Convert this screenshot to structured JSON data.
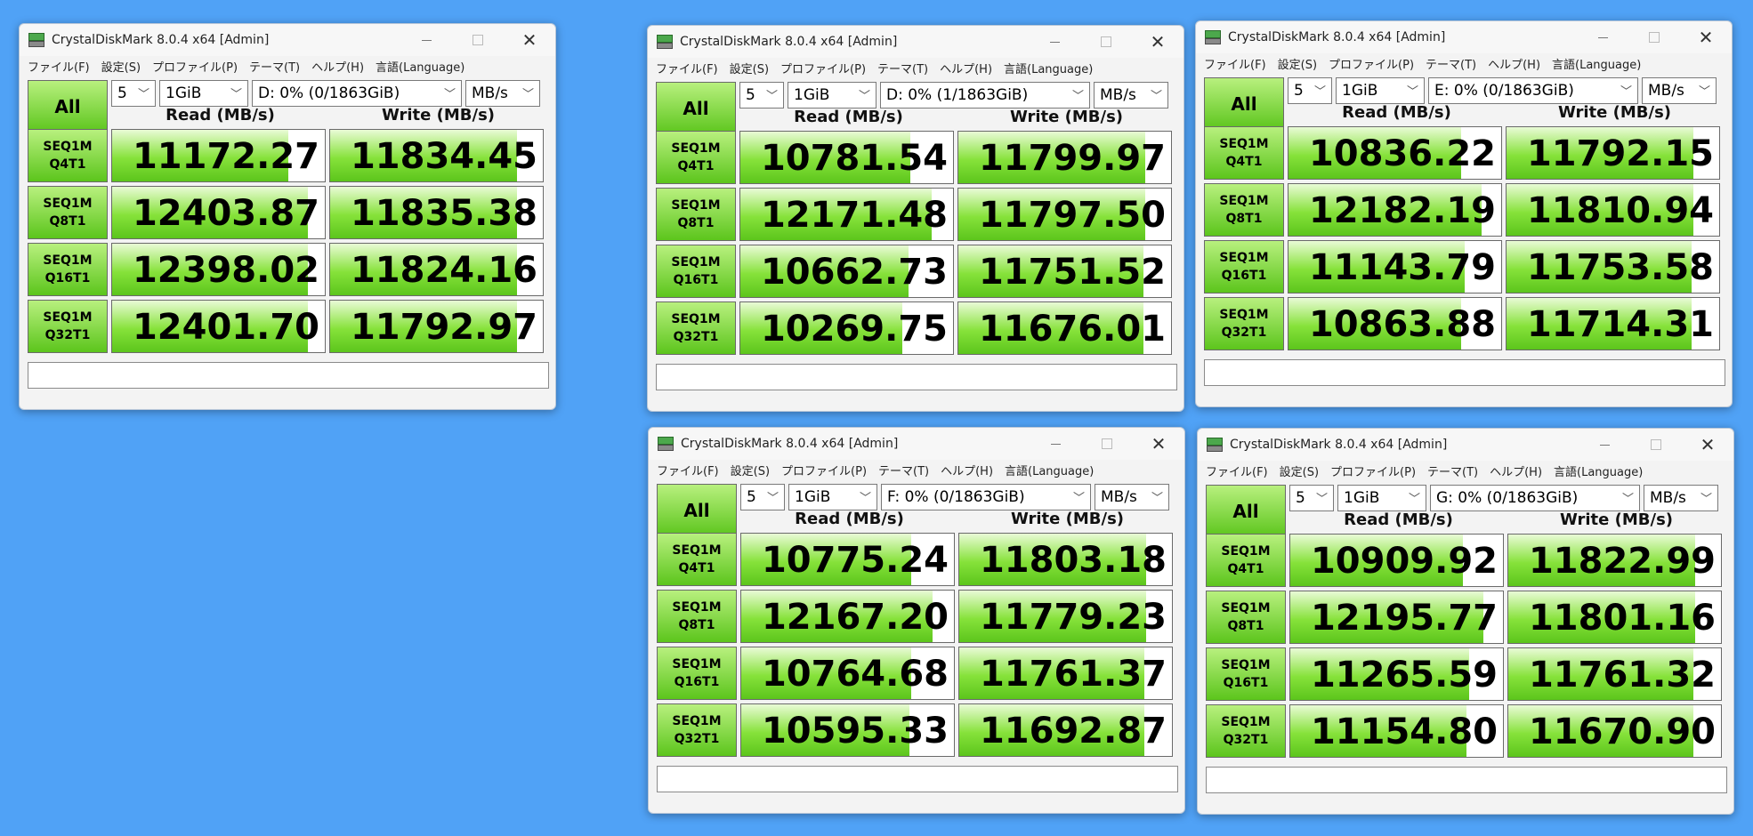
{
  "common": {
    "title": "CrystalDiskMark 8.0.4 x64 [Admin]",
    "menu": [
      "ファイル(F)",
      "設定(S)",
      "プロファイル(P)",
      "テーマ(T)",
      "ヘルプ(H)",
      "言語(Language)"
    ],
    "all_label": "All",
    "count": "5",
    "size": "1GiB",
    "unit": "MB/s",
    "read_header": "Read (MB/s)",
    "write_header": "Write (MB/s)",
    "tests": [
      {
        "line1": "SEQ1M",
        "line2": "Q4T1"
      },
      {
        "line1": "SEQ1M",
        "line2": "Q8T1"
      },
      {
        "line1": "SEQ1M",
        "line2": "Q16T1"
      },
      {
        "line1": "SEQ1M",
        "line2": "Q32T1"
      }
    ],
    "accent_green": "#5cc51c",
    "desktop_blue": "#50a2f6"
  },
  "windows": [
    {
      "drive": "D: 0% (0/1863GiB)",
      "read": [
        "11172.27",
        "12403.87",
        "12398.02",
        "12401.70"
      ],
      "write": [
        "11834.45",
        "11835.38",
        "11824.16",
        "11792.97"
      ],
      "read_fill": [
        0.83,
        0.92,
        0.92,
        0.92
      ],
      "write_fill": [
        0.88,
        0.88,
        0.88,
        0.88
      ]
    },
    {
      "drive": "D: 0% (1/1863GiB)",
      "read": [
        "10781.54",
        "12171.48",
        "10662.73",
        "10269.75"
      ],
      "write": [
        "11799.97",
        "11797.50",
        "11751.52",
        "11676.01"
      ],
      "read_fill": [
        0.8,
        0.9,
        0.79,
        0.76
      ],
      "write_fill": [
        0.88,
        0.88,
        0.87,
        0.87
      ]
    },
    {
      "drive": "E: 0% (0/1863GiB)",
      "read": [
        "10836.22",
        "12182.19",
        "11143.79",
        "10863.88"
      ],
      "write": [
        "11792.15",
        "11810.94",
        "11753.58",
        "11714.31"
      ],
      "read_fill": [
        0.81,
        0.91,
        0.83,
        0.81
      ],
      "write_fill": [
        0.88,
        0.88,
        0.87,
        0.87
      ]
    },
    {
      "drive": "F: 0% (0/1863GiB)",
      "read": [
        "10775.24",
        "12167.20",
        "10764.68",
        "10595.33"
      ],
      "write": [
        "11803.18",
        "11779.23",
        "11761.37",
        "11692.87"
      ],
      "read_fill": [
        0.8,
        0.9,
        0.8,
        0.79
      ],
      "write_fill": [
        0.88,
        0.88,
        0.87,
        0.87
      ]
    },
    {
      "drive": "G: 0% (0/1863GiB)",
      "read": [
        "10909.92",
        "12195.77",
        "11265.59",
        "11154.80"
      ],
      "write": [
        "11822.99",
        "11801.16",
        "11761.32",
        "11670.90"
      ],
      "read_fill": [
        0.81,
        0.91,
        0.84,
        0.83
      ],
      "write_fill": [
        0.88,
        0.88,
        0.87,
        0.87
      ]
    }
  ]
}
